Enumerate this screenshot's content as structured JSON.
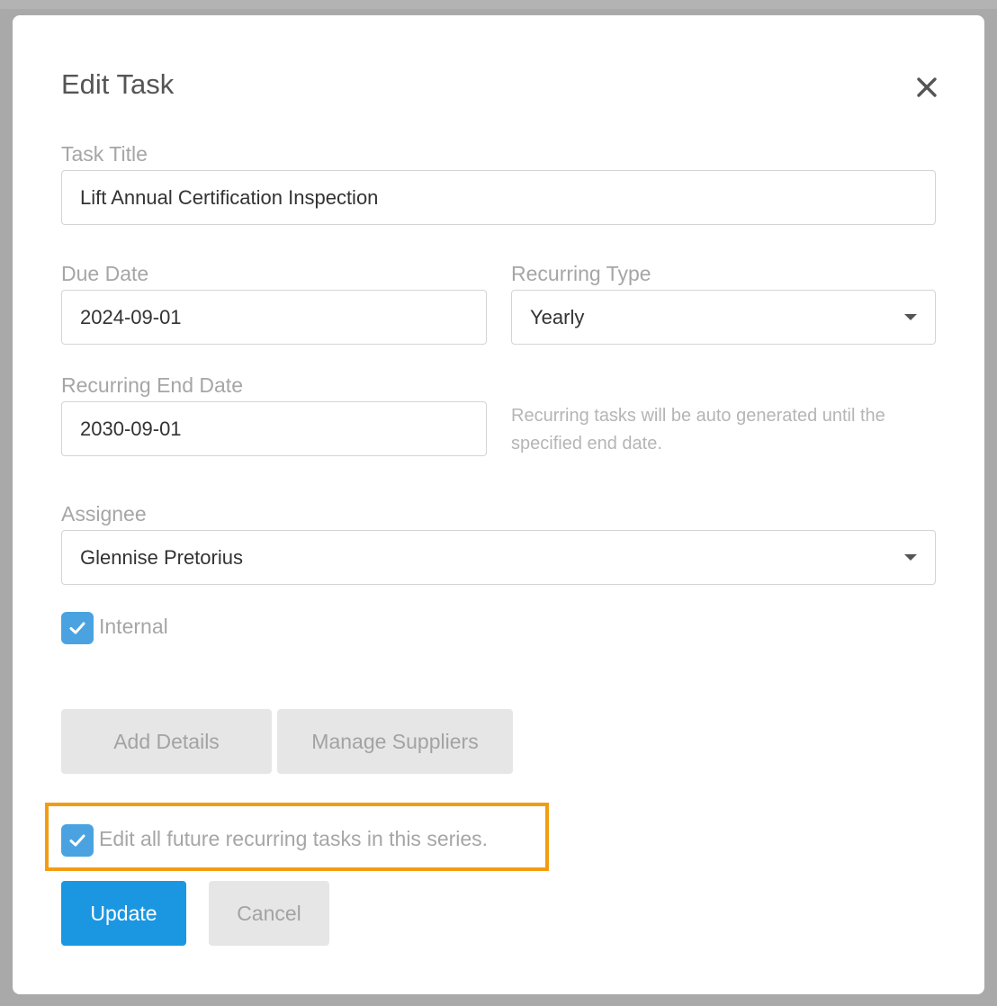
{
  "dialog": {
    "title": "Edit Task"
  },
  "form": {
    "task_title": {
      "label": "Task Title",
      "value": "Lift Annual Certification Inspection"
    },
    "due_date": {
      "label": "Due Date",
      "value": "2024-09-01"
    },
    "recurring_type": {
      "label": "Recurring Type",
      "value": "Yearly"
    },
    "recurring_end_date": {
      "label": "Recurring End Date",
      "value": "2030-09-01"
    },
    "recurring_hint": "Recurring tasks will be auto generated until the specified end date.",
    "assignee": {
      "label": "Assignee",
      "value": "Glennise Pretorius"
    },
    "internal": {
      "label": "Internal",
      "checked": true
    },
    "edit_future": {
      "label": "Edit all future recurring tasks in this series.",
      "checked": true
    }
  },
  "buttons": {
    "add_details": "Add Details",
    "manage_suppliers": "Manage Suppliers",
    "update": "Update",
    "cancel": "Cancel"
  },
  "colors": {
    "primary": "#1b97e2",
    "checkbox": "#4aa3e0",
    "highlight": "#f39c12"
  },
  "icons": {
    "close": "close-icon",
    "caret": "caret-down-icon",
    "check": "checkmark-icon"
  }
}
